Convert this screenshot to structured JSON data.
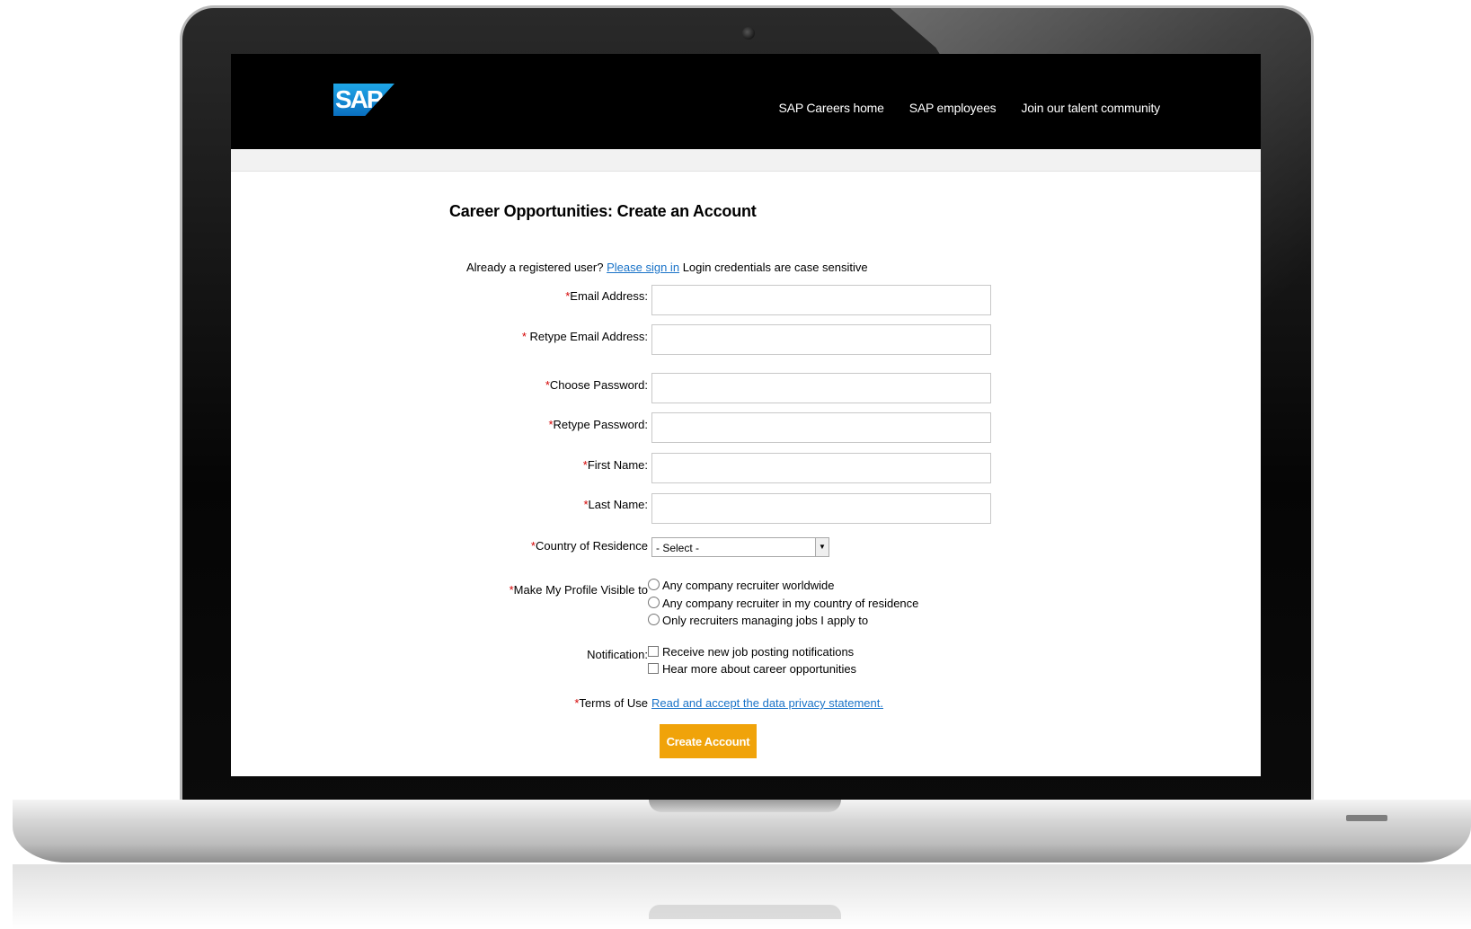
{
  "header": {
    "logo_text": "SAP",
    "nav": [
      {
        "label": "SAP Careers home"
      },
      {
        "label": "SAP employees"
      },
      {
        "label": "Join our talent community"
      }
    ]
  },
  "form": {
    "title": "Career Opportunities: Create an Account",
    "signin": {
      "prefix": "Already a registered user?",
      "link": "Please sign in",
      "suffix": "Login credentials are case sensitive"
    },
    "required_mark": "*",
    "fields": {
      "email": {
        "label": "Email Address:",
        "value": ""
      },
      "retype_email": {
        "label": " Retype Email Address:",
        "value": ""
      },
      "password": {
        "label": "Choose Password:",
        "value": ""
      },
      "retype_password": {
        "label": "Retype Password:",
        "value": ""
      },
      "first_name": {
        "label": "First Name:",
        "value": ""
      },
      "last_name": {
        "label": "Last Name:",
        "value": ""
      }
    },
    "country": {
      "label": "Country of Residence",
      "selected": "- Select -"
    },
    "visibility": {
      "label": "Make My Profile Visible to",
      "options": [
        "Any company recruiter worldwide",
        "Any company recruiter in my country of residence",
        "Only recruiters managing jobs I apply to"
      ]
    },
    "notification": {
      "label": "Notification:",
      "options": [
        "Receive new job posting notifications",
        "Hear more about career opportunities"
      ]
    },
    "terms": {
      "label": "Terms of Use",
      "link": "Read and accept the data privacy statement."
    },
    "submit_label": "Create Account"
  }
}
